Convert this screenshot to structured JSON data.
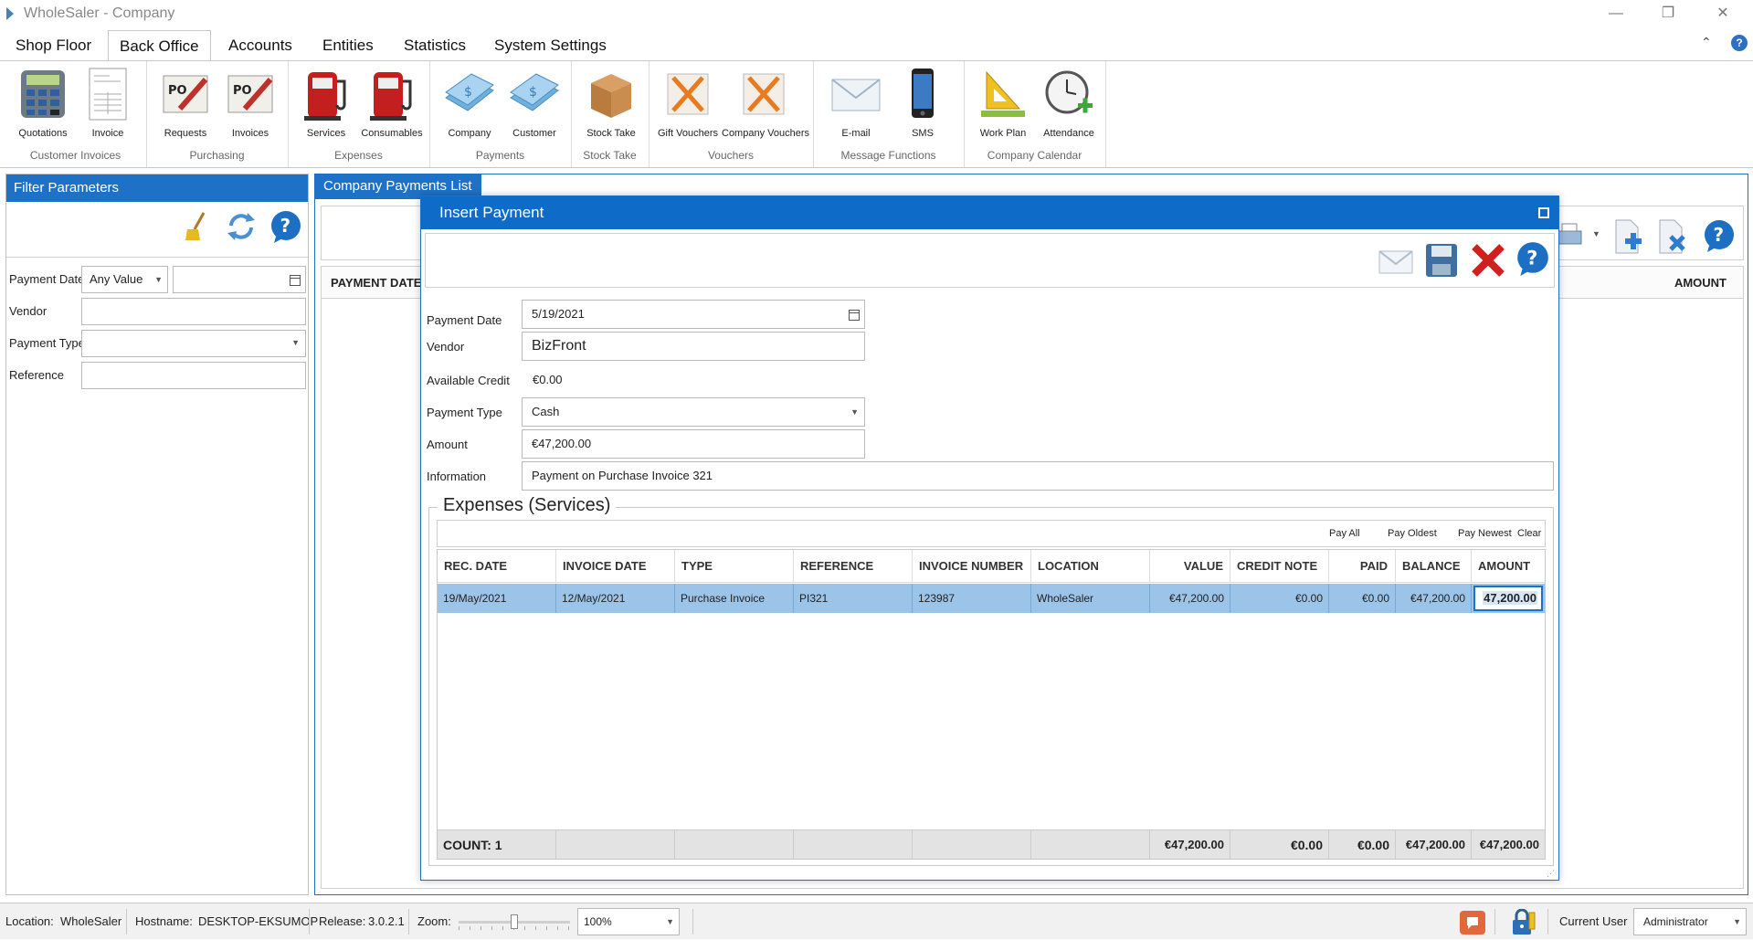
{
  "window": {
    "title": "WholeSaler - Company"
  },
  "menu": {
    "tabs": [
      "Shop Floor",
      "Back Office",
      "Accounts",
      "Entities",
      "Statistics",
      "System Settings"
    ]
  },
  "ribbon": {
    "buttons": [
      "Quotations",
      "Invoice",
      "Requests",
      "Invoices",
      "Services",
      "Consumables",
      "Company",
      "Customer",
      "Stock Take",
      "Gift Vouchers",
      "Company Vouchers",
      "E-mail",
      "SMS",
      "Work Plan",
      "Attendance"
    ],
    "groups": [
      "Customer Invoices",
      "Purchasing",
      "Expenses",
      "Payments",
      "Stock Take",
      "Vouchers",
      "Message Functions",
      "Company Calendar"
    ]
  },
  "filter": {
    "title": "Filter Parameters",
    "payment_date_label": "Payment Date",
    "payment_date_option": "Any Value",
    "vendor_label": "Vendor",
    "payment_type_label": "Payment Type",
    "reference_label": "Reference"
  },
  "list": {
    "tab": "Company Payments List",
    "col_payment_date": "PAYMENT DATE",
    "col_amount": "AMOUNT"
  },
  "dialog": {
    "title": "Insert Payment",
    "payment_date_label": "Payment Date",
    "payment_date": "5/19/2021",
    "vendor_label": "Vendor",
    "vendor": "BizFront",
    "available_credit_label": "Available Credit",
    "available_credit": "€0.00",
    "payment_type_label": "Payment Type",
    "payment_type": "Cash",
    "amount_label": "Amount",
    "amount": "€47,200.00",
    "information_label": "Information",
    "information": "Payment on Purchase Invoice 321",
    "section_title": "Expenses (Services)",
    "actions": {
      "pay_all": "Pay All",
      "pay_oldest": "Pay Oldest",
      "pay_newest": "Pay Newest",
      "clear": "Clear"
    },
    "grid": {
      "headers": [
        "REC. DATE",
        "INVOICE DATE",
        "TYPE",
        "REFERENCE",
        "INVOICE NUMBER",
        "LOCATION",
        "VALUE",
        "CREDIT NOTE",
        "PAID",
        "BALANCE",
        "AMOUNT"
      ],
      "rows": [
        [
          "19/May/2021",
          "12/May/2021",
          "Purchase Invoice",
          "PI321",
          "123987",
          "WholeSaler",
          "€47,200.00",
          "€0.00",
          "€0.00",
          "€47,200.00",
          "47,200.00"
        ]
      ],
      "footer": {
        "count": "COUNT:  1",
        "value": "€47,200.00",
        "credit_note": "€0.00",
        "paid": "€0.00",
        "balance": "€47,200.00",
        "amount": "€47,200.00"
      }
    }
  },
  "status": {
    "location_label": "Location:",
    "location": "WholeSaler",
    "hostname_label": "Hostname:",
    "hostname": "DESKTOP-EKSUMOP",
    "release_label": "Release:",
    "release": "3.0.2.1",
    "zoom_label": "Zoom:",
    "zoom": "100%",
    "zoom_level": 0.5,
    "current_user_label": "Current User",
    "current_user": "Administrator"
  },
  "colors": {
    "accent": "#1d72c8",
    "selected_row": "#9cc3e8",
    "footer": "#e3e3e3"
  }
}
